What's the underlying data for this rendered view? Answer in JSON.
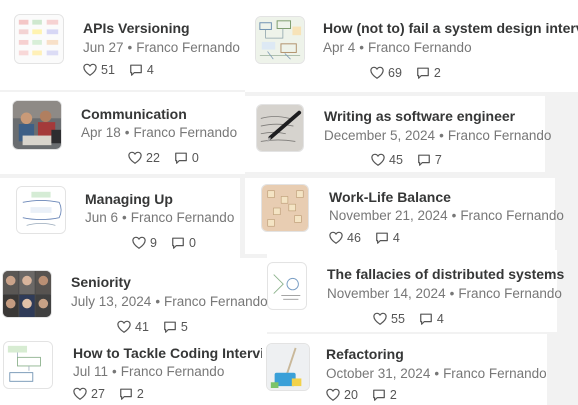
{
  "author": "Franco Fernando",
  "posts": [
    {
      "title": "APIs Versioning",
      "date": "Jun 27",
      "likes": "51",
      "comments": "4"
    },
    {
      "title": "How (not to) fail a system design interview",
      "date": "Apr 4",
      "likes": "69",
      "comments": "2"
    },
    {
      "title": "Communication",
      "date": "Apr 18",
      "likes": "22",
      "comments": "0"
    },
    {
      "title": "Writing as software engineer",
      "date": "December 5, 2024",
      "likes": "45",
      "comments": "7"
    },
    {
      "title": "Managing Up",
      "date": "Jun 6",
      "likes": "9",
      "comments": "0"
    },
    {
      "title": "Work-Life Balance",
      "date": "November 21, 2024",
      "likes": "46",
      "comments": "4"
    },
    {
      "title": "Seniority",
      "date": "July 13, 2024",
      "likes": "41",
      "comments": "5"
    },
    {
      "title": "The fallacies of distributed systems",
      "date": "November 14, 2024",
      "likes": "55",
      "comments": "4"
    },
    {
      "title": "How to Tackle Coding Interviews",
      "date": "Jul 11",
      "likes": "27",
      "comments": "2"
    },
    {
      "title": "Refactoring",
      "date": "October 31, 2024",
      "likes": "20",
      "comments": "2"
    }
  ],
  "thumb_icons": [
    "api-versioning-diagram-thumbnail",
    "system-design-whiteboard-thumbnail",
    "team-meeting-photo-thumbnail",
    "pen-writing-notebook-thumbnail",
    "managing-up-sketch-thumbnail",
    "scrabble-tiles-thumbnail",
    "people-portraits-thumbnail",
    "distributed-systems-sketch-thumbnail",
    "coding-interview-flowchart-thumbnail",
    "cleaning-bucket-thumbnail"
  ]
}
